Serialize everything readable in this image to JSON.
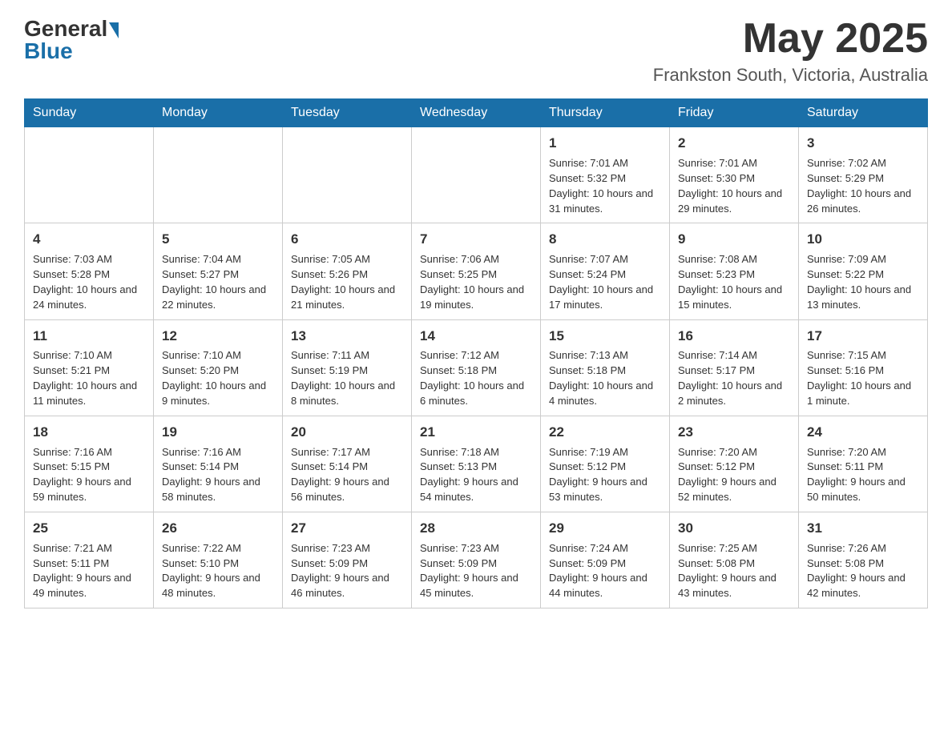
{
  "header": {
    "logo_general": "General",
    "logo_blue": "Blue",
    "month_title": "May 2025",
    "location": "Frankston South, Victoria, Australia"
  },
  "days_of_week": [
    "Sunday",
    "Monday",
    "Tuesday",
    "Wednesday",
    "Thursday",
    "Friday",
    "Saturday"
  ],
  "weeks": [
    [
      {
        "day": "",
        "info": ""
      },
      {
        "day": "",
        "info": ""
      },
      {
        "day": "",
        "info": ""
      },
      {
        "day": "",
        "info": ""
      },
      {
        "day": "1",
        "info": "Sunrise: 7:01 AM\nSunset: 5:32 PM\nDaylight: 10 hours and 31 minutes."
      },
      {
        "day": "2",
        "info": "Sunrise: 7:01 AM\nSunset: 5:30 PM\nDaylight: 10 hours and 29 minutes."
      },
      {
        "day": "3",
        "info": "Sunrise: 7:02 AM\nSunset: 5:29 PM\nDaylight: 10 hours and 26 minutes."
      }
    ],
    [
      {
        "day": "4",
        "info": "Sunrise: 7:03 AM\nSunset: 5:28 PM\nDaylight: 10 hours and 24 minutes."
      },
      {
        "day": "5",
        "info": "Sunrise: 7:04 AM\nSunset: 5:27 PM\nDaylight: 10 hours and 22 minutes."
      },
      {
        "day": "6",
        "info": "Sunrise: 7:05 AM\nSunset: 5:26 PM\nDaylight: 10 hours and 21 minutes."
      },
      {
        "day": "7",
        "info": "Sunrise: 7:06 AM\nSunset: 5:25 PM\nDaylight: 10 hours and 19 minutes."
      },
      {
        "day": "8",
        "info": "Sunrise: 7:07 AM\nSunset: 5:24 PM\nDaylight: 10 hours and 17 minutes."
      },
      {
        "day": "9",
        "info": "Sunrise: 7:08 AM\nSunset: 5:23 PM\nDaylight: 10 hours and 15 minutes."
      },
      {
        "day": "10",
        "info": "Sunrise: 7:09 AM\nSunset: 5:22 PM\nDaylight: 10 hours and 13 minutes."
      }
    ],
    [
      {
        "day": "11",
        "info": "Sunrise: 7:10 AM\nSunset: 5:21 PM\nDaylight: 10 hours and 11 minutes."
      },
      {
        "day": "12",
        "info": "Sunrise: 7:10 AM\nSunset: 5:20 PM\nDaylight: 10 hours and 9 minutes."
      },
      {
        "day": "13",
        "info": "Sunrise: 7:11 AM\nSunset: 5:19 PM\nDaylight: 10 hours and 8 minutes."
      },
      {
        "day": "14",
        "info": "Sunrise: 7:12 AM\nSunset: 5:18 PM\nDaylight: 10 hours and 6 minutes."
      },
      {
        "day": "15",
        "info": "Sunrise: 7:13 AM\nSunset: 5:18 PM\nDaylight: 10 hours and 4 minutes."
      },
      {
        "day": "16",
        "info": "Sunrise: 7:14 AM\nSunset: 5:17 PM\nDaylight: 10 hours and 2 minutes."
      },
      {
        "day": "17",
        "info": "Sunrise: 7:15 AM\nSunset: 5:16 PM\nDaylight: 10 hours and 1 minute."
      }
    ],
    [
      {
        "day": "18",
        "info": "Sunrise: 7:16 AM\nSunset: 5:15 PM\nDaylight: 9 hours and 59 minutes."
      },
      {
        "day": "19",
        "info": "Sunrise: 7:16 AM\nSunset: 5:14 PM\nDaylight: 9 hours and 58 minutes."
      },
      {
        "day": "20",
        "info": "Sunrise: 7:17 AM\nSunset: 5:14 PM\nDaylight: 9 hours and 56 minutes."
      },
      {
        "day": "21",
        "info": "Sunrise: 7:18 AM\nSunset: 5:13 PM\nDaylight: 9 hours and 54 minutes."
      },
      {
        "day": "22",
        "info": "Sunrise: 7:19 AM\nSunset: 5:12 PM\nDaylight: 9 hours and 53 minutes."
      },
      {
        "day": "23",
        "info": "Sunrise: 7:20 AM\nSunset: 5:12 PM\nDaylight: 9 hours and 52 minutes."
      },
      {
        "day": "24",
        "info": "Sunrise: 7:20 AM\nSunset: 5:11 PM\nDaylight: 9 hours and 50 minutes."
      }
    ],
    [
      {
        "day": "25",
        "info": "Sunrise: 7:21 AM\nSunset: 5:11 PM\nDaylight: 9 hours and 49 minutes."
      },
      {
        "day": "26",
        "info": "Sunrise: 7:22 AM\nSunset: 5:10 PM\nDaylight: 9 hours and 48 minutes."
      },
      {
        "day": "27",
        "info": "Sunrise: 7:23 AM\nSunset: 5:09 PM\nDaylight: 9 hours and 46 minutes."
      },
      {
        "day": "28",
        "info": "Sunrise: 7:23 AM\nSunset: 5:09 PM\nDaylight: 9 hours and 45 minutes."
      },
      {
        "day": "29",
        "info": "Sunrise: 7:24 AM\nSunset: 5:09 PM\nDaylight: 9 hours and 44 minutes."
      },
      {
        "day": "30",
        "info": "Sunrise: 7:25 AM\nSunset: 5:08 PM\nDaylight: 9 hours and 43 minutes."
      },
      {
        "day": "31",
        "info": "Sunrise: 7:26 AM\nSunset: 5:08 PM\nDaylight: 9 hours and 42 minutes."
      }
    ]
  ]
}
